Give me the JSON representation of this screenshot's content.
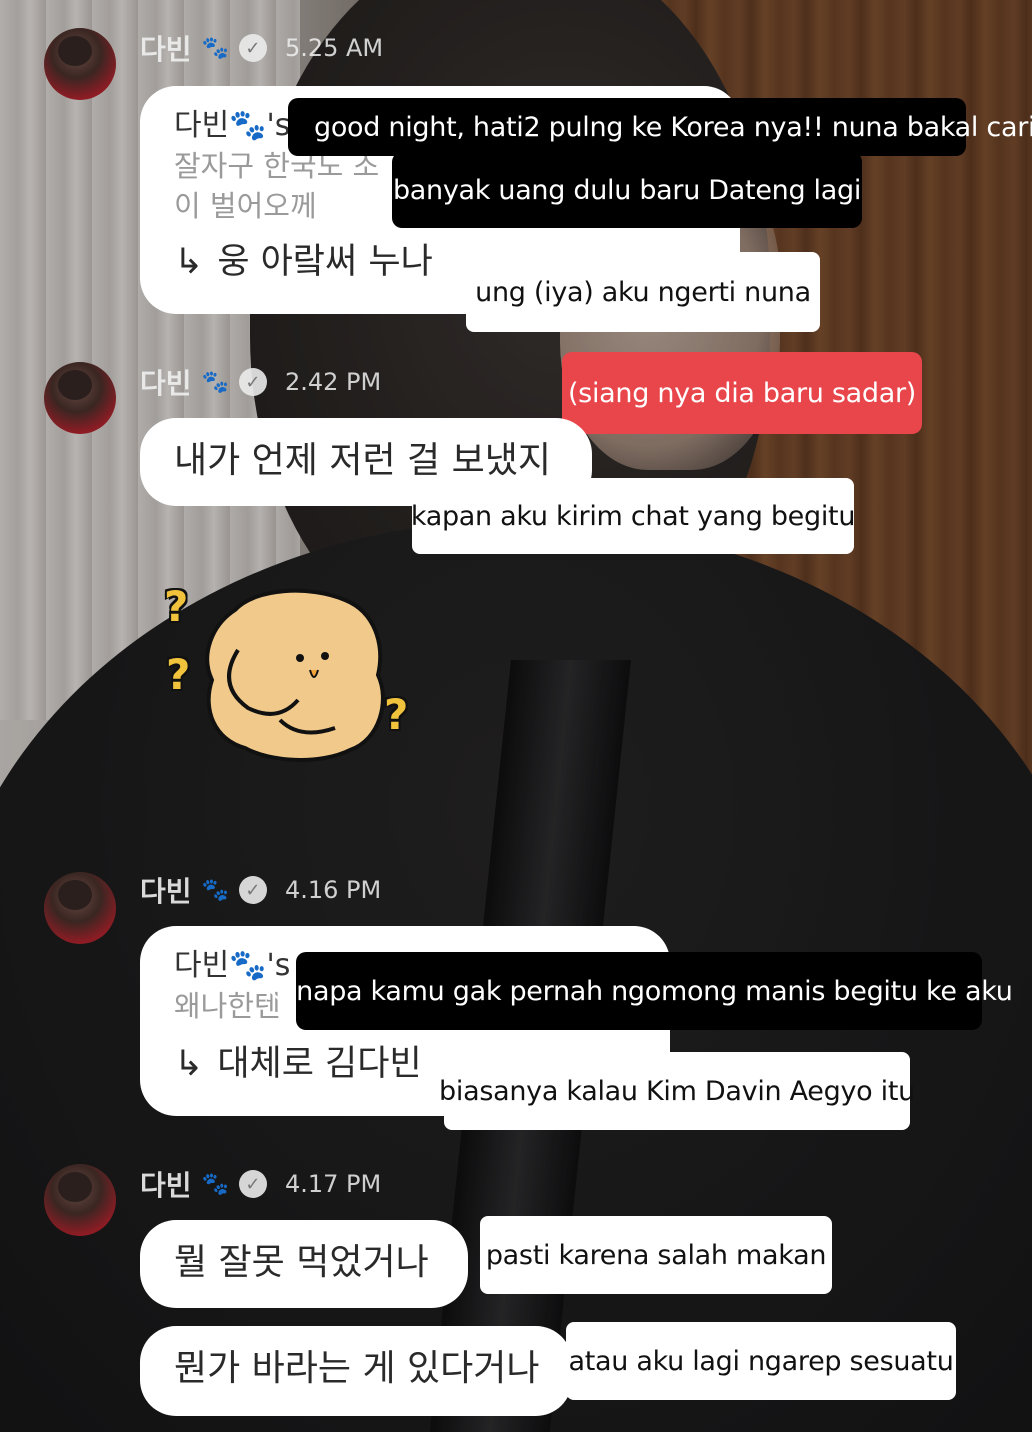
{
  "sender": {
    "name": "다빈",
    "paw": "🐾",
    "verified_icon": "check-badge-icon",
    "avatar_icon": "profile-avatar"
  },
  "messages": [
    {
      "time": "5.25 AM",
      "quoted_name": "다빈🐾's",
      "quoted_text_lines": [
        "잘자구 한국도 조",
        "이 벌어오께"
      ],
      "reply_arrow": "↳",
      "reply": "웅 아랔써 누나"
    },
    {
      "time": "2.42 PM",
      "text": "내가 언제 저런 걸 보냈지"
    },
    {
      "time": "4.16 PM",
      "quoted_name": "다빈🐾's",
      "quoted_text_lines": [
        "왜나한텐"
      ],
      "reply_arrow": "↳",
      "reply": "대체로 김다빈"
    },
    {
      "time": "4.17 PM",
      "texts": [
        "뭘 잘못 먹었거나",
        "뭔가 바라는 게 있다거나"
      ]
    }
  ],
  "captions": {
    "c1_line1": "good night, hati2 pulng ke Korea nya!! nuna bakal cari",
    "c1_line2": "banyak uang dulu baru Dateng lagi",
    "c2": "ung (iya) aku ngerti nuna",
    "c3": "(siang nya dia baru sadar)",
    "c4": "kapan aku kirim chat yang begitu",
    "c5": "kenapa kamu gak pernah ngomong manis begitu ke aku",
    "c6": "biasanya kalau Kim Davin Aegyo itu",
    "c7": "pasti karena salah makan",
    "c8": "atau aku lagi ngarep sesuatu"
  },
  "sticker": {
    "name": "confused-bread-sticker",
    "marks": [
      "?",
      "?",
      "?"
    ]
  },
  "colors": {
    "red_caption": "#e8464b",
    "bubble": "#ffffff",
    "black_caption": "#000000"
  }
}
